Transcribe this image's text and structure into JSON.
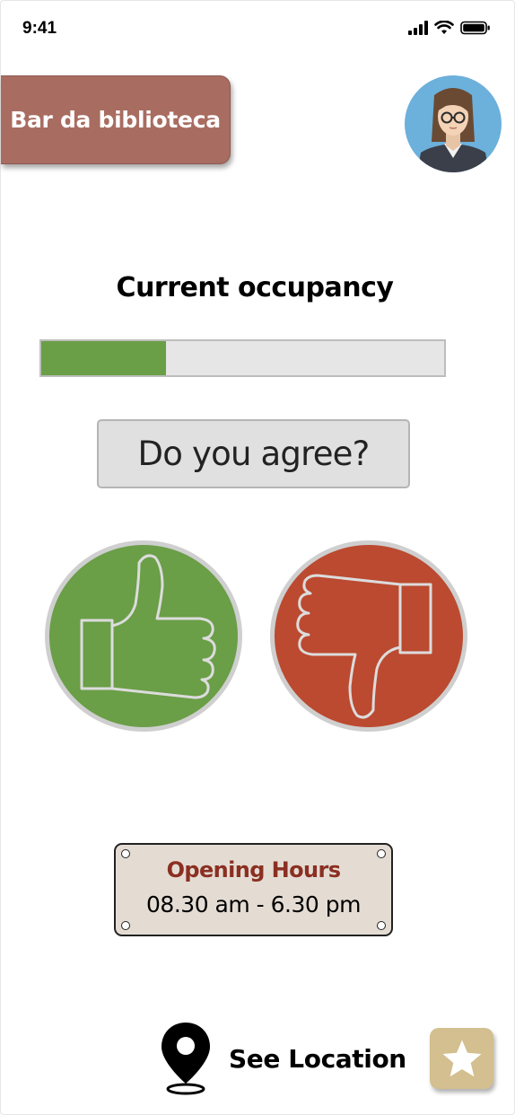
{
  "status_bar": {
    "time": "9:41"
  },
  "header": {
    "place_name": "Bar da biblioteca",
    "avatar_icon": "user-avatar-icon"
  },
  "occupancy": {
    "title": "Current occupancy",
    "level_percent": 31,
    "fill_color": "#6a9e47"
  },
  "feedback": {
    "question": "Do you agree?",
    "agree_icon": "thumbs-up-icon",
    "disagree_icon": "thumbs-down-icon",
    "agree_color": "#6a9e47",
    "disagree_color": "#bb4a30"
  },
  "opening_hours": {
    "title": "Opening Hours",
    "value": "08.30 am - 6.30 pm"
  },
  "footer": {
    "location_label": "See Location",
    "location_icon": "map-pin-icon",
    "favorite_icon": "star-icon",
    "accent_color": "#d3bf8f"
  }
}
